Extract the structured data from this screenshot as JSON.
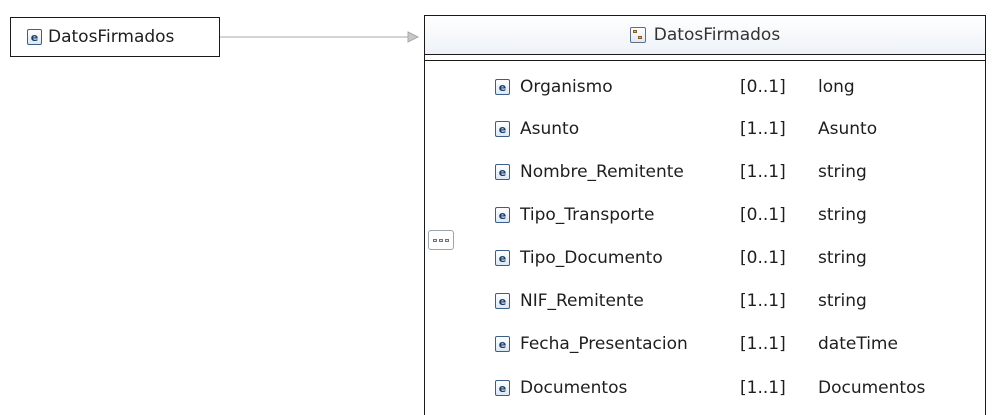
{
  "root_element": {
    "icon": "element-icon",
    "icon_glyph": "e",
    "name": "DatosFirmados"
  },
  "complex_type": {
    "icon": "complex-type-icon",
    "name": "DatosFirmados",
    "compositor_icon": "sequence-icon",
    "children": [
      {
        "name": "Organismo",
        "cardinality": "[0..1]",
        "type": "long"
      },
      {
        "name": "Asunto",
        "cardinality": "[1..1]",
        "type": "Asunto"
      },
      {
        "name": "Nombre_Remitente",
        "cardinality": "[1..1]",
        "type": "string"
      },
      {
        "name": "Tipo_Transporte",
        "cardinality": "[0..1]",
        "type": "string"
      },
      {
        "name": "Tipo_Documento",
        "cardinality": "[0..1]",
        "type": "string"
      },
      {
        "name": "NIF_Remitente",
        "cardinality": "[1..1]",
        "type": "string"
      },
      {
        "name": "Fecha_Presentacion",
        "cardinality": "[1..1]",
        "type": "dateTime"
      },
      {
        "name": "Documentos",
        "cardinality": "[1..1]",
        "type": "Documentos"
      }
    ]
  },
  "colors": {
    "border": "#1a1a1a",
    "connector": "#a0a0a0",
    "icon_border": "#3b5f86"
  }
}
